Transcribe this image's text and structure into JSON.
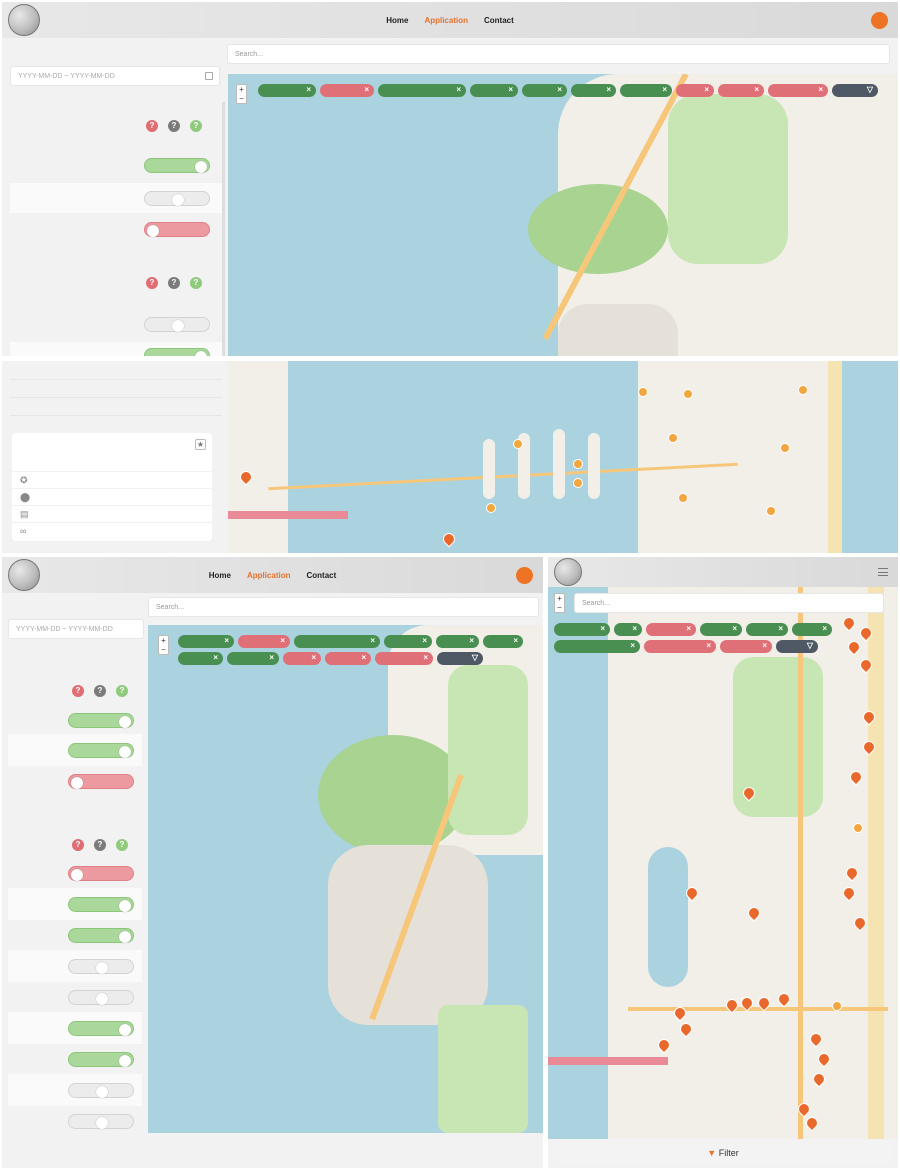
{
  "nav": {
    "home": "Home",
    "application": "Application",
    "contact": "Contact"
  },
  "search": {
    "placeholder": "Search..."
  },
  "date_range": {
    "placeholder": "YYYY-MM-DD ~ YYYY-MM-DD"
  },
  "help_buttons": [
    "?",
    "?",
    "?"
  ],
  "chip_remove": "×",
  "mobile": {
    "filter_label": "Filter"
  },
  "icons": [
    "award-icon",
    "map-marker-icon",
    "id-card-icon",
    "link-icon",
    "star-icon",
    "filter-icon",
    "menu-icon",
    "calendar-icon"
  ],
  "colors": {
    "accent": "#e5732d",
    "toggle_on": "#a9d89a",
    "toggle_off": "#ec9aa0",
    "chip_green": "#4a8f52",
    "chip_red": "#e07078",
    "chip_dark": "#4f5865",
    "water": "#aad3df"
  }
}
